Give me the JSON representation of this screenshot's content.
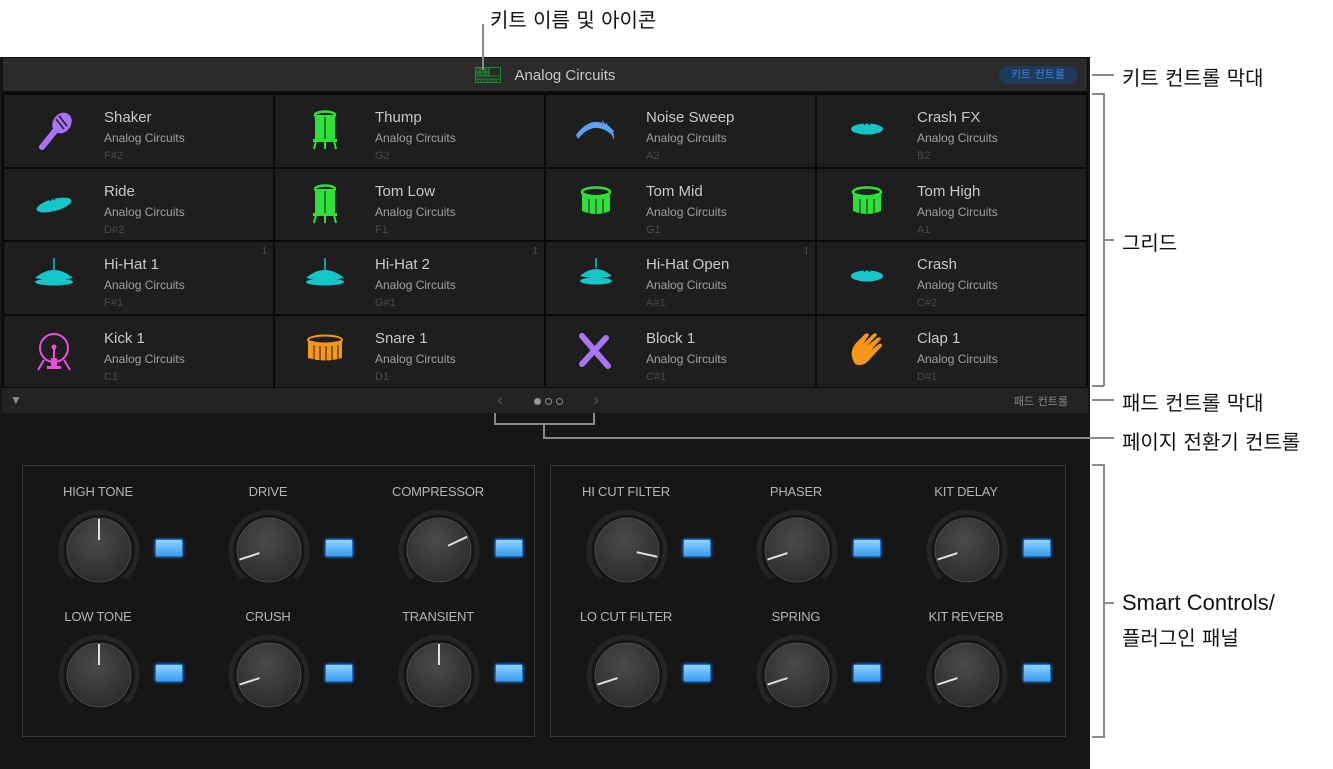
{
  "kit_bar": {
    "kit_name": "Analog Circuits",
    "kit_icon": "drum-machine-grid-icon",
    "kit_icon_color": "#1f8a2e",
    "kit_controls_label": "키트 컨트롤"
  },
  "pads": [
    {
      "name": "Shaker",
      "kit": "Analog Circuits",
      "note": "F#2",
      "icon": "maraca-icon",
      "color": "#a873f5",
      "badge": ""
    },
    {
      "name": "Thump",
      "kit": "Analog Circuits",
      "note": "G2",
      "icon": "tall-drum-icon",
      "color": "#2fe03a",
      "badge": ""
    },
    {
      "name": "Noise Sweep",
      "kit": "Analog Circuits",
      "note": "A2",
      "icon": "noise-wave-icon",
      "color": "#5aa2ef",
      "badge": ""
    },
    {
      "name": "Crash FX",
      "kit": "Analog Circuits",
      "note": "B2",
      "icon": "cymbal-icon",
      "color": "#15c6c9",
      "badge": ""
    },
    {
      "name": "Ride",
      "kit": "Analog Circuits",
      "note": "D#2",
      "icon": "ride-cymbal-icon",
      "color": "#15c6c9",
      "badge": ""
    },
    {
      "name": "Tom Low",
      "kit": "Analog Circuits",
      "note": "F1",
      "icon": "tall-drum-icon",
      "color": "#2fe03a",
      "badge": ""
    },
    {
      "name": "Tom Mid",
      "kit": "Analog Circuits",
      "note": "G1",
      "icon": "tom-drum-icon",
      "color": "#2fe03a",
      "badge": ""
    },
    {
      "name": "Tom High",
      "kit": "Analog Circuits",
      "note": "A1",
      "icon": "tom-drum-icon",
      "color": "#2fe03a",
      "badge": ""
    },
    {
      "name": "Hi-Hat 1",
      "kit": "Analog Circuits",
      "note": "F#1",
      "icon": "hihat-icon",
      "color": "#15c6c9",
      "badge": "1"
    },
    {
      "name": "Hi-Hat 2",
      "kit": "Analog Circuits",
      "note": "G#1",
      "icon": "hihat-icon",
      "color": "#15c6c9",
      "badge": "1"
    },
    {
      "name": "Hi-Hat Open",
      "kit": "Analog Circuits",
      "note": "A#1",
      "icon": "hihat-open-icon",
      "color": "#15c6c9",
      "badge": "1"
    },
    {
      "name": "Crash",
      "kit": "Analog Circuits",
      "note": "C#2",
      "icon": "cymbal-icon",
      "color": "#15c6c9",
      "badge": ""
    },
    {
      "name": "Kick 1",
      "kit": "Analog Circuits",
      "note": "C1",
      "icon": "kick-drum-icon",
      "color": "#ee4ee0",
      "badge": ""
    },
    {
      "name": "Snare 1",
      "kit": "Analog Circuits",
      "note": "D1",
      "icon": "snare-drum-icon",
      "color": "#f5961a",
      "badge": ""
    },
    {
      "name": "Block 1",
      "kit": "Analog Circuits",
      "note": "C#1",
      "icon": "crossed-sticks-icon",
      "color": "#a873f5",
      "badge": ""
    },
    {
      "name": "Clap 1",
      "kit": "Analog Circuits",
      "note": "D#1",
      "icon": "clap-hand-icon",
      "color": "#f5961a",
      "badge": ""
    }
  ],
  "pad_bar": {
    "collapse_glyph": "▼",
    "prev_glyph": "‹",
    "next_glyph": "›",
    "pages": 3,
    "current_page": 1,
    "pad_controls_label": "패드 컨트롤"
  },
  "smart_controls": {
    "left": [
      {
        "label": "HIGH TONE",
        "value": 0.5
      },
      {
        "label": "DRIVE",
        "value": 0.1
      },
      {
        "label": "COMPRESSOR",
        "value": 0.74
      },
      {
        "label": "LOW TONE",
        "value": 0.5
      },
      {
        "label": "CRUSH",
        "value": 0.1
      },
      {
        "label": "TRANSIENT",
        "value": 0.5
      }
    ],
    "right": [
      {
        "label": "HI CUT FILTER",
        "value": 0.88
      },
      {
        "label": "PHASER",
        "value": 0.1
      },
      {
        "label": "KIT DELAY",
        "value": 0.1
      },
      {
        "label": "LO CUT FILTER",
        "value": 0.1
      },
      {
        "label": "SPRING",
        "value": 0.1
      },
      {
        "label": "KIT REVERB",
        "value": 0.1
      }
    ],
    "led_color": "#4aaaf5"
  },
  "callouts": {
    "kit_name_icon": "키트 이름 및 아이콘",
    "kit_control_bar": "키트 컨트롤 막대",
    "grid": "그리드",
    "pad_control_bar": "패드 컨트롤 막대",
    "page_switcher": "페이지 전환기 컨트롤",
    "smart_controls_line1": "Smart Controls/",
    "smart_controls_line2": "플러그인 패널"
  }
}
